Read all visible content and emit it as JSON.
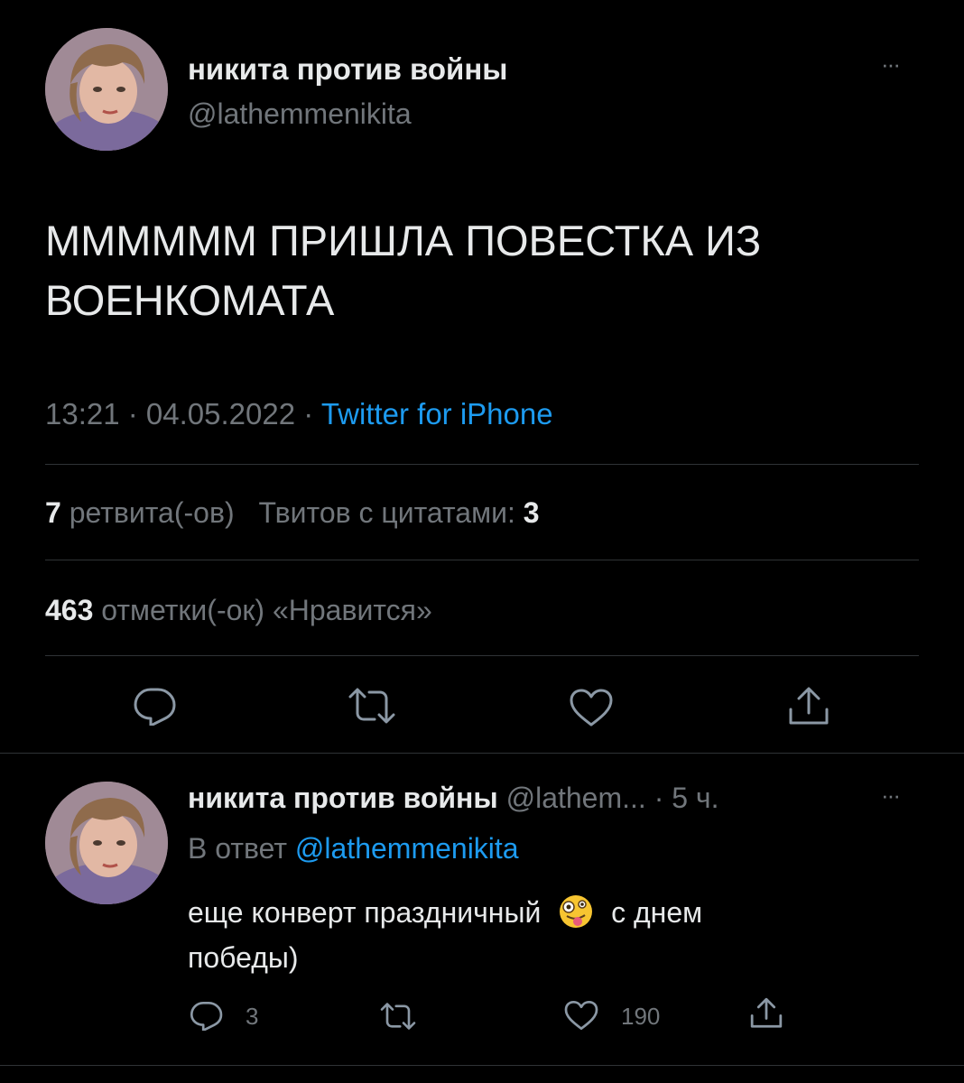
{
  "main_tweet": {
    "display_name": "никита против войны",
    "handle": "@lathemmenikita",
    "text_line1": "ММММММ ПРИШЛА ПОВЕСТКА ИЗ",
    "text_line2": "ВОЕНКОМАТА",
    "time": "13:21 · 04.05.2022 · ",
    "source": "Twitter for iPhone",
    "retweets_count": "7",
    "retweets_label": " ретвита(-ов)",
    "quotes_label": "Твитов с цитатами: ",
    "quotes_count": "3",
    "likes_count": "463",
    "likes_label": " отметки(-ок) «Нравится»",
    "more_label": "···"
  },
  "reply_tweet": {
    "display_name": "никита против войны",
    "meta": " @lathem... · 5 ч.",
    "reply_prefix": "В ответ ",
    "reply_handle": "@lathemmenikita",
    "text_part1": "еще конверт праздничный",
    "text_part2": "с днем",
    "text_line2": "победы)",
    "reply_count": "3",
    "like_count": "190",
    "more_label": "···"
  },
  "icons": {
    "actions": [
      "reply-icon",
      "retweet-icon",
      "like-icon",
      "share-icon"
    ],
    "emoji": "zany-face-emoji"
  },
  "colors": {
    "background": "#000000",
    "text": "#e7e9ea",
    "secondary": "#71767b",
    "link": "#1d9bf0",
    "divider": "#2f3336"
  }
}
